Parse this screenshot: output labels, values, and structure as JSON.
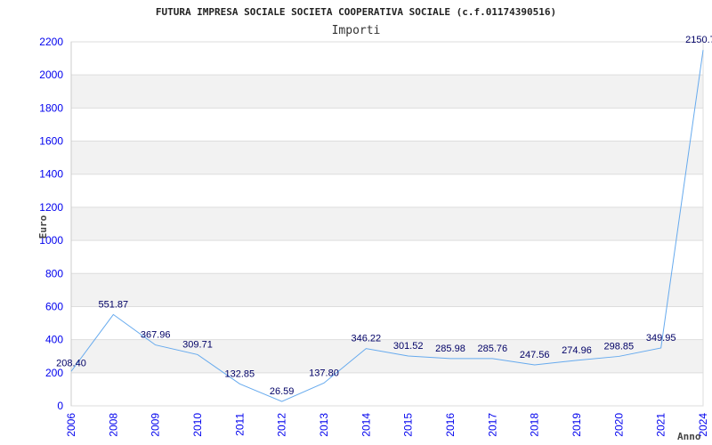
{
  "chart_data": {
    "type": "line",
    "title": "FUTURA IMPRESA SOCIALE SOCIETA COOPERATIVA SOCIALE (c.f.01174390516)",
    "subtitle": "Importi",
    "xlabel": "Anno",
    "ylabel": "Euro",
    "categories": [
      "2006",
      "2008",
      "2009",
      "2010",
      "2011",
      "2012",
      "2013",
      "2014",
      "2015",
      "2016",
      "2017",
      "2018",
      "2019",
      "2020",
      "2021",
      "2024"
    ],
    "values": [
      208.4,
      551.87,
      367.96,
      309.71,
      132.85,
      26.59,
      137.8,
      346.22,
      301.52,
      285.98,
      285.76,
      247.56,
      274.96,
      298.85,
      349.95,
      2150.7
    ],
    "ylim": [
      0,
      2200
    ],
    "yticks": [
      0,
      200,
      400,
      600,
      800,
      1000,
      1200,
      1400,
      1600,
      1800,
      2000,
      2200
    ],
    "grid": true,
    "legend": "none",
    "colors": {
      "line": "#66aaee",
      "band": "#f2f2f2",
      "grid": "#dddddd",
      "tick": "#0000ee",
      "label": "#000066"
    }
  }
}
